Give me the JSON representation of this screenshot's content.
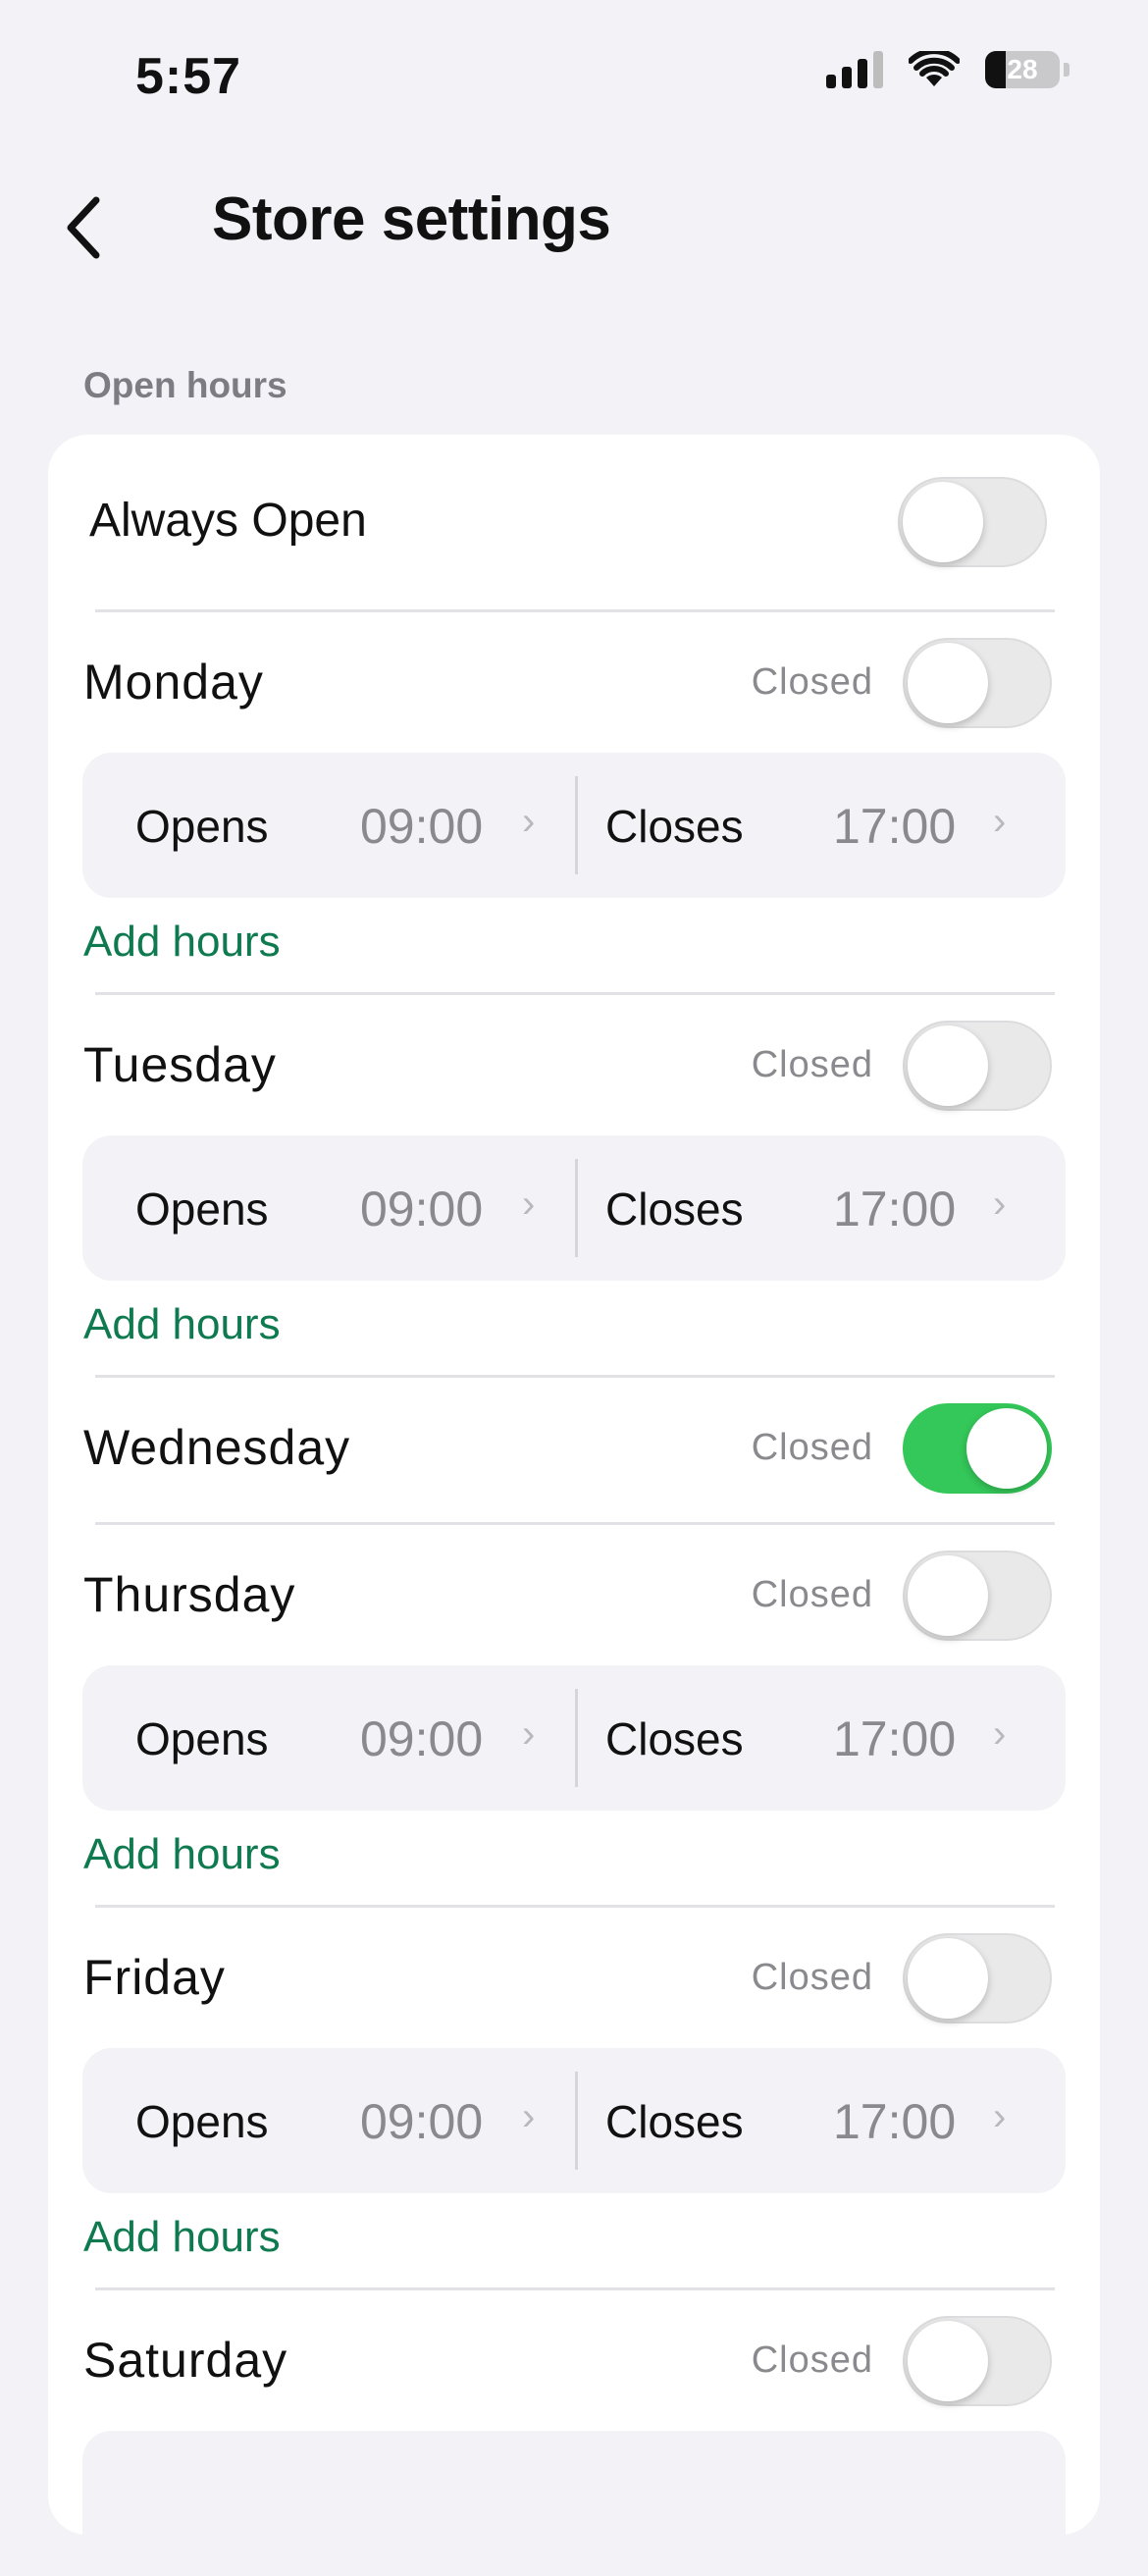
{
  "status": {
    "time": "5:57",
    "battery": "28"
  },
  "nav": {
    "title": "Store settings"
  },
  "section": {
    "label": "Open hours"
  },
  "always_open": {
    "label": "Always Open",
    "on": false
  },
  "days": [
    {
      "name": "Monday",
      "closed_label": "Closed",
      "closed_on": false,
      "opens_label": "Opens",
      "opens": "09:00",
      "closes_label": "Closes",
      "closes": "17:00",
      "add_hours": "Add hours"
    },
    {
      "name": "Tuesday",
      "closed_label": "Closed",
      "closed_on": false,
      "opens_label": "Opens",
      "opens": "09:00",
      "closes_label": "Closes",
      "closes": "17:00",
      "add_hours": "Add hours"
    },
    {
      "name": "Wednesday",
      "closed_label": "Closed",
      "closed_on": true
    },
    {
      "name": "Thursday",
      "closed_label": "Closed",
      "closed_on": false,
      "opens_label": "Opens",
      "opens": "09:00",
      "closes_label": "Closes",
      "closes": "17:00",
      "add_hours": "Add hours"
    },
    {
      "name": "Friday",
      "closed_label": "Closed",
      "closed_on": false,
      "opens_label": "Opens",
      "opens": "09:00",
      "closes_label": "Closes",
      "closes": "17:00",
      "add_hours": "Add hours"
    },
    {
      "name": "Saturday",
      "closed_label": "Closed",
      "closed_on": false
    }
  ],
  "colors": {
    "accent_green": "#34c759",
    "link_green": "#0f7a4f",
    "background": "#f2f2f7"
  },
  "icons": {
    "back": "chevron-left-icon",
    "row_chevron": "chevron-right-icon",
    "signal": "cellular-signal-icon",
    "wifi": "wifi-icon",
    "battery": "battery-icon"
  }
}
